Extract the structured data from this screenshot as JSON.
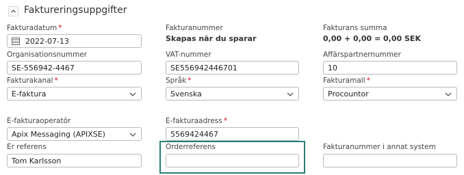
{
  "section": {
    "title": "Faktureringsuppgifter"
  },
  "fields": {
    "fakturadatum": {
      "label": "Fakturadatum",
      "value": "2022-07-13"
    },
    "fakturanummer": {
      "label": "Fakturanummer",
      "value": "Skapas när du sparar"
    },
    "fakturans_summa": {
      "label": "Fakturans summa",
      "value": "0,00 + 0,00 = 0,00 SEK"
    },
    "organisationsnummer": {
      "label": "Organisationsnummer",
      "value": "SE-556942-4467"
    },
    "vat_nummer": {
      "label": "VAT-nummer",
      "value": "SE556942446701"
    },
    "affarspartnernummer": {
      "label": "Affärspartnernummer",
      "value": "10"
    },
    "fakturakanal": {
      "label": "Fakturakanal",
      "value": "E-faktura"
    },
    "sprak": {
      "label": "Språk",
      "value": "Svenska"
    },
    "fakturamall": {
      "label": "Fakturamall",
      "value": "Procountor"
    },
    "e_fakturaoperator": {
      "label": "E-fakturaoperatör",
      "value": "Apix Messaging (APIXSE)"
    },
    "e_fakturaadress": {
      "label": "E-fakturaadress",
      "value": "5569424467"
    },
    "er_referens": {
      "label": "Er referens",
      "value": "Tom Karlsson"
    },
    "orderreferens": {
      "label": "Orderreferens",
      "value": ""
    },
    "fakturanummer_annat": {
      "label": "Fakturanummer i annat system",
      "value": ""
    }
  },
  "required_marker": "*",
  "icons": {
    "collapse": "chevron-up-icon",
    "calendar": "calendar-icon",
    "dropdown": "chevron-down-icon"
  },
  "colors": {
    "focus_border": "#2a7d77",
    "required": "#d0021b",
    "input_border": "#b9b9b9"
  }
}
